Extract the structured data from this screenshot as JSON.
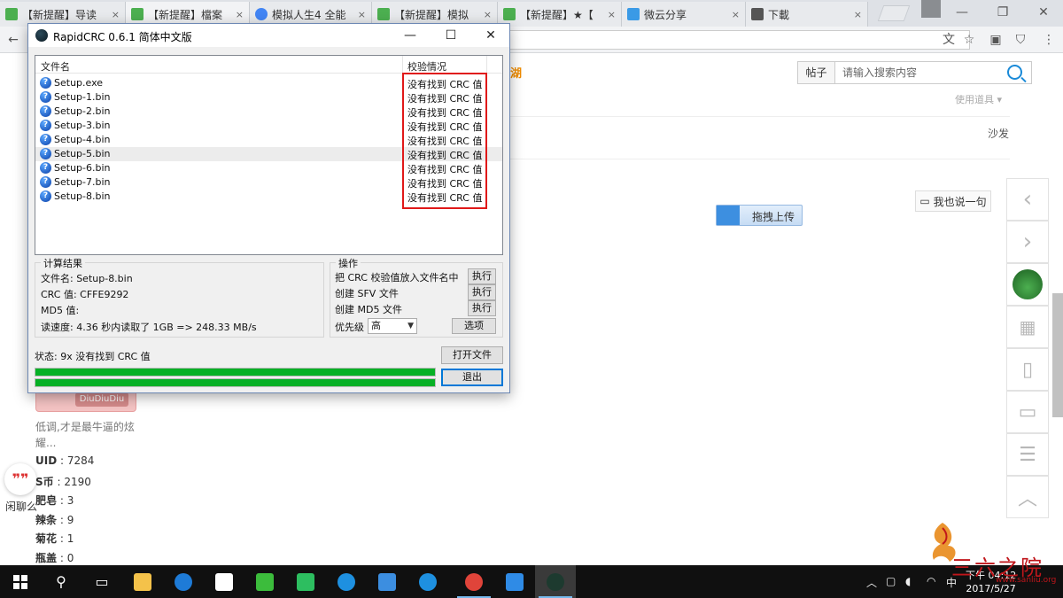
{
  "browser": {
    "tabs": [
      {
        "label": "【新提醒】导读",
        "color": "#4caf50"
      },
      {
        "label": "【新提醒】檔案",
        "color": "#4caf50"
      },
      {
        "label": "模拟人生4 全能",
        "color": "#4285f4"
      },
      {
        "label": "【新提醒】模拟",
        "color": "#4caf50"
      },
      {
        "label": "【新提醒】★【",
        "color": "#4caf50"
      },
      {
        "label": "微云分享",
        "color": "#3a9ae6"
      },
      {
        "label": "下載",
        "color": "#555555"
      }
    ],
    "tab_close": "×",
    "window_controls": {
      "minimize": "—",
      "maximize": "❐",
      "close": "✕"
    }
  },
  "page": {
    "search": {
      "button": "帖子",
      "placeholder": "请输入搜索内容"
    },
    "orange_text": "湖",
    "use_menu": "使用道具 ▾",
    "sofa": "沙发",
    "say_button": "我也说一句",
    "upload_button": "拖拽上传",
    "profile": {
      "motto": "低调,才是最牛逼的炫耀...",
      "stats": [
        {
          "key": "UID",
          "sep": " : ",
          "value": "7284"
        },
        {
          "key": "S币",
          "sep": " : ",
          "value": "2190"
        },
        {
          "key": "肥皂",
          "sep": " : ",
          "value": "3"
        },
        {
          "key": "辣条",
          "sep": " : ",
          "value": "9"
        },
        {
          "key": "菊花",
          "sep": " : ",
          "value": "1"
        },
        {
          "key": "瓶盖",
          "sep": " : ",
          "value": "0"
        }
      ],
      "badge_tag": "DiuDiuDiu"
    },
    "chat_label": "闲聊么",
    "quote_mark": "❞❞"
  },
  "rapidcrc": {
    "title": "RapidCRC 0.6.1 简体中文版",
    "columns": {
      "filename": "文件名",
      "status": "校验情况"
    },
    "files": [
      {
        "name": "Setup.exe",
        "status": "没有找到 CRC 值"
      },
      {
        "name": "Setup-1.bin",
        "status": "没有找到 CRC 值"
      },
      {
        "name": "Setup-2.bin",
        "status": "没有找到 CRC 值"
      },
      {
        "name": "Setup-3.bin",
        "status": "没有找到 CRC 值"
      },
      {
        "name": "Setup-4.bin",
        "status": "没有找到 CRC 值"
      },
      {
        "name": "Setup-5.bin",
        "status": "没有找到 CRC 值"
      },
      {
        "name": "Setup-6.bin",
        "status": "没有找到 CRC 值"
      },
      {
        "name": "Setup-7.bin",
        "status": "没有找到 CRC 值"
      },
      {
        "name": "Setup-8.bin",
        "status": "没有找到 CRC 值"
      }
    ],
    "selected_index": 5,
    "result": {
      "group_title": "计算结果",
      "filename": "文件名:  Setup-8.bin",
      "crc": "CRC 值:  CFFE9292",
      "md5": "MD5 值:",
      "speed": "读速度:  4.36 秒内读取了 1GB => 248.33 MB/s"
    },
    "operations": {
      "group_title": "操作",
      "items": [
        {
          "label": "把 CRC 校验值放入文件名中",
          "button": "执行"
        },
        {
          "label": "创建 SFV 文件",
          "button": "执行"
        },
        {
          "label": "创建 MD5 文件",
          "button": "执行"
        }
      ],
      "priority_label": "优先级",
      "priority_value": "高",
      "options_button": "选项"
    },
    "status": "状态:    9x 没有找到 CRC 值",
    "open_file_button": "打开文件",
    "exit_button": "退出",
    "progress": [
      1.0,
      1.0
    ]
  },
  "taskbar": {
    "clock_time": "下午 04:12",
    "clock_date": "2017/5/27",
    "ime": "中",
    "apps": [
      {
        "name": "file-explorer",
        "color": "#f4c24a"
      },
      {
        "name": "edge",
        "color": "#1e7bd7"
      },
      {
        "name": "store",
        "color": "#ffffff"
      },
      {
        "name": "wechat",
        "color": "#3cbc3c"
      },
      {
        "name": "evernote",
        "color": "#2dbe60"
      },
      {
        "name": "ie",
        "color": "#1e90e0"
      },
      {
        "name": "mail",
        "color": "#3c8ee0"
      },
      {
        "name": "ie2",
        "color": "#1e90e0"
      },
      {
        "name": "chrome",
        "color": "#e0443a"
      },
      {
        "name": "baidu-netdisk",
        "color": "#2f8be6"
      },
      {
        "name": "rapidcrc",
        "color": "#1d3a2f"
      }
    ]
  },
  "watermark": {
    "text": "三六之院",
    "url": "www.sanliu.org"
  }
}
